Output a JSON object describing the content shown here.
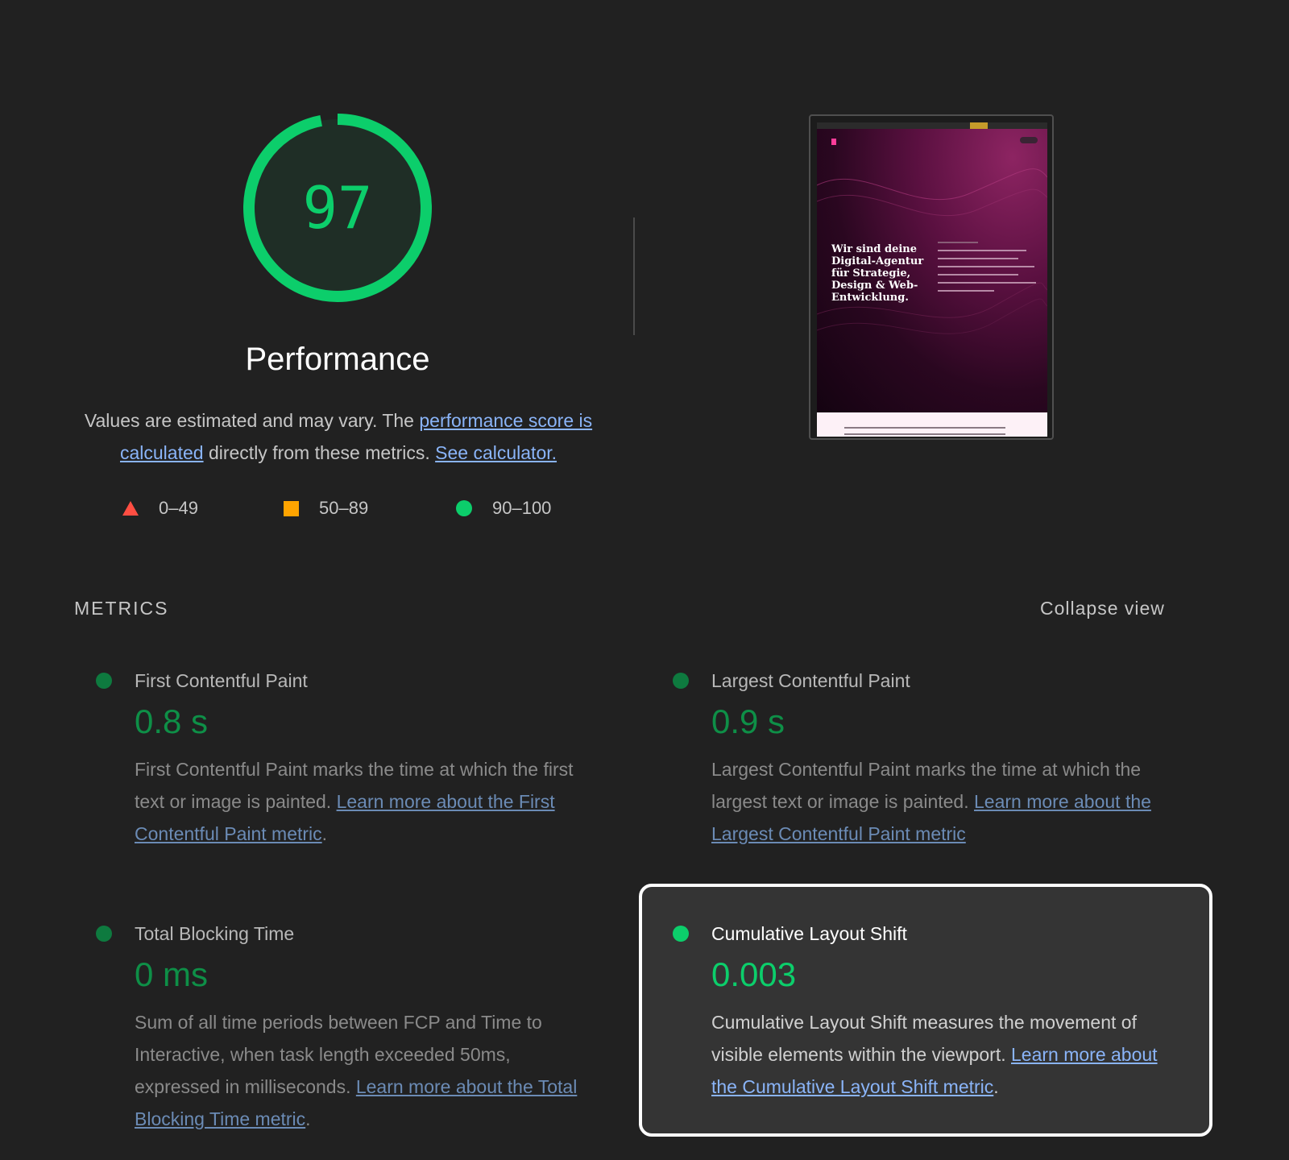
{
  "score": {
    "value": "97",
    "fraction": 0.97,
    "color": "#0cce6b",
    "title": "Performance"
  },
  "description": {
    "prefix": "Values are estimated and may vary. The ",
    "link1": "performance score is calculated",
    "middle": " directly from these metrics. ",
    "link2": "See calculator."
  },
  "legend": [
    {
      "label": "0–49",
      "shape": "triangle",
      "color": "#ff4e42"
    },
    {
      "label": "50–89",
      "shape": "square",
      "color": "#ffa400"
    },
    {
      "label": "90–100",
      "shape": "circle",
      "color": "#0cce6b"
    }
  ],
  "thumbnail": {
    "heading": "Wir sind deine Digital-Agentur für Strategie, Design & Web-Entwicklung."
  },
  "metrics_section": {
    "title": "METRICS",
    "collapse_label": "Collapse view"
  },
  "metrics": [
    {
      "title": "First Contentful Paint",
      "value": "0.8 s",
      "desc": "First Contentful Paint marks the time at which the first text or image is painted. ",
      "link": "Learn more about the First Contentful Paint metric",
      "suffix": "."
    },
    {
      "title": "Largest Contentful Paint",
      "value": "0.9 s",
      "desc": "Largest Contentful Paint marks the time at which the largest text or image is painted. ",
      "link": "Learn more about the Largest Contentful Paint metric",
      "suffix": ""
    },
    {
      "title": "Total Blocking Time",
      "value": "0 ms",
      "desc": "Sum of all time periods between FCP and Time to Interactive, when task length exceeded 50ms, expressed in milliseconds. ",
      "link": "Learn more about the Total Blocking Time metric",
      "suffix": "."
    },
    {
      "title": "Cumulative Layout Shift",
      "value": "0.003",
      "desc": "Cumulative Layout Shift measures the movement of visible elements within the viewport. ",
      "link": "Learn more about the Cumulative Layout Shift metric",
      "suffix": "."
    }
  ]
}
